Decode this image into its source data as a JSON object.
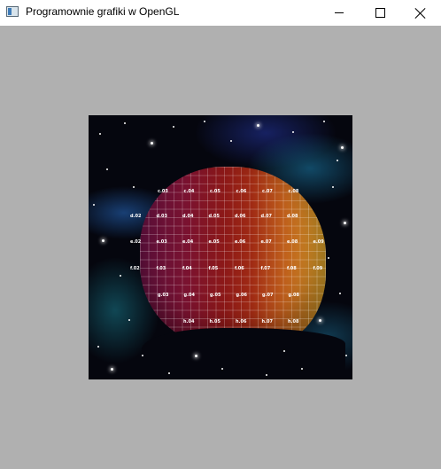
{
  "window": {
    "title": "Programownie grafiki w OpenGL",
    "icon": "app-window-icon",
    "controls": [
      {
        "name": "minimize",
        "icon": "minimize-icon"
      },
      {
        "name": "maximize",
        "icon": "maximize-icon"
      },
      {
        "name": "close",
        "icon": "close-icon"
      }
    ]
  },
  "colors": {
    "client_background": "#b0b0b0",
    "space": "#05060e",
    "planet_left": "#5a0f3a",
    "planet_right": "#d8a02a"
  },
  "scene": {
    "labels": [
      [
        "c.03",
        "c.04",
        "c.05",
        "c.06",
        "c.07",
        "c.08"
      ],
      [
        "d.02",
        "d.03",
        "d.04",
        "d.05",
        "d.06",
        "d.07",
        "d.08"
      ],
      [
        "e.02",
        "e.03",
        "e.04",
        "e.05",
        "e.06",
        "e.07",
        "e.08",
        "e.09"
      ],
      [
        "f.02",
        "f.03",
        "f.04",
        "f.05",
        "f.06",
        "f.07",
        "f.08",
        "f.09"
      ],
      [
        "g.03",
        "g.04",
        "g.05",
        "g.06",
        "g.07",
        "g.08"
      ],
      [
        "h.04",
        "h.05",
        "h.06",
        "h.07",
        "h.08"
      ]
    ]
  }
}
